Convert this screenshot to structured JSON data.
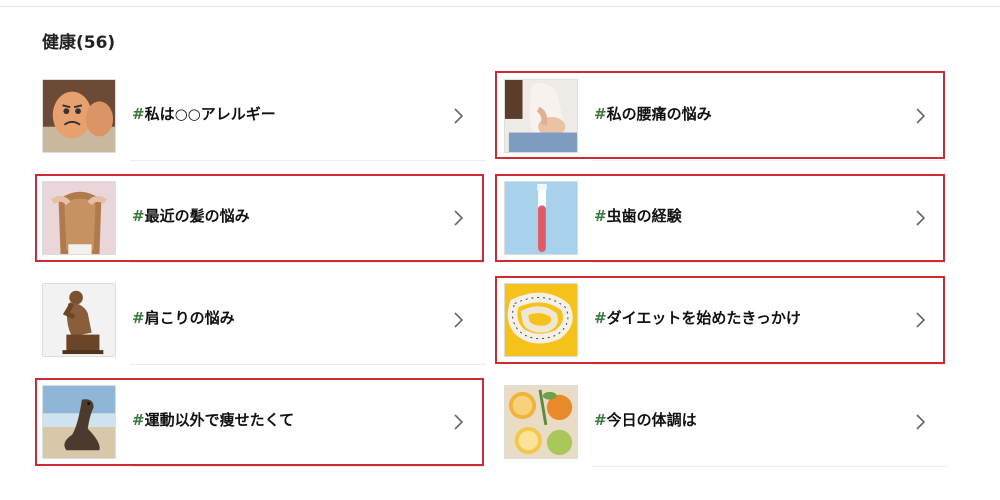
{
  "section": {
    "title": "健康(56)"
  },
  "topics": [
    {
      "hash": "#",
      "label": "私は○○アレルギー",
      "icon": "egg-face-icon",
      "highlighted": false
    },
    {
      "hash": "#",
      "label": "私の腰痛の悩み",
      "icon": "back-pain-icon",
      "highlighted": true
    },
    {
      "hash": "#",
      "label": "最近の髪の悩み",
      "icon": "hair-icon",
      "highlighted": true
    },
    {
      "hash": "#",
      "label": "虫歯の経験",
      "icon": "toothbrush-icon",
      "highlighted": true
    },
    {
      "hash": "#",
      "label": "肩こりの悩み",
      "icon": "thinker-statue-icon",
      "highlighted": false
    },
    {
      "hash": "#",
      "label": "ダイエットを始めたきっかけ",
      "icon": "measuring-tape-icon",
      "highlighted": true
    },
    {
      "hash": "#",
      "label": "運動以外で痩せたくて",
      "icon": "sea-lion-icon",
      "highlighted": true
    },
    {
      "hash": "#",
      "label": "今日の体調は",
      "icon": "citrus-fruit-icon",
      "highlighted": false
    }
  ],
  "colors": {
    "highlight": "#cc2b36",
    "hash": "#3d7a3d"
  }
}
